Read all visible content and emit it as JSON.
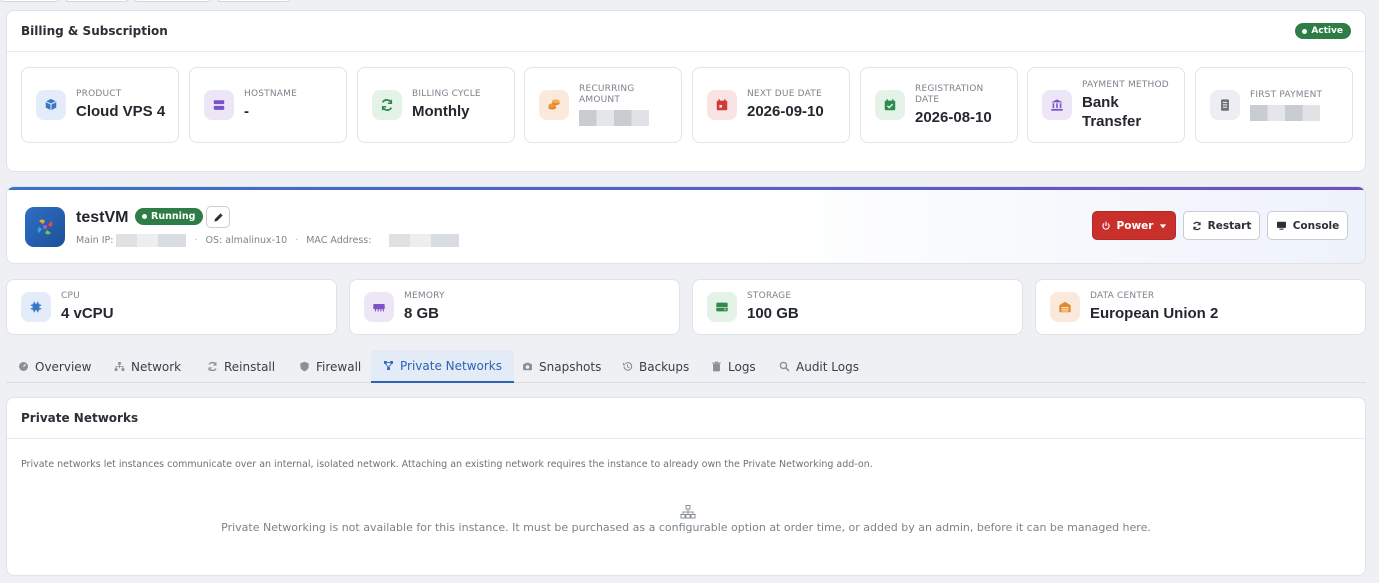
{
  "billing": {
    "title": "Billing & Subscription",
    "status": "Active",
    "items": [
      {
        "label": "PRODUCT",
        "value": "Cloud VPS 4",
        "icon": "cube-icon"
      },
      {
        "label": "HOSTNAME",
        "value": "-",
        "icon": "server-icon"
      },
      {
        "label": "BILLING CYCLE",
        "value": "Monthly",
        "icon": "refresh-icon"
      },
      {
        "label": "RECURRING AMOUNT",
        "value": "",
        "icon": "coins-icon"
      },
      {
        "label": "NEXT DUE DATE",
        "value": "2026-09-10",
        "icon": "calendar-icon"
      },
      {
        "label": "REGISTRATION DATE",
        "value": "2026-08-10",
        "icon": "calendar-check-icon"
      },
      {
        "label": "PAYMENT METHOD",
        "value": "Bank Transfer",
        "icon": "bank-icon"
      },
      {
        "label": "FIRST PAYMENT",
        "value": "",
        "icon": "receipt-icon"
      }
    ]
  },
  "vm": {
    "name": "testVM",
    "status": "Running",
    "main_ip_label": "Main IP:",
    "os_label": "OS: almalinux-10",
    "mac_label": "MAC Address:",
    "power_label": "Power",
    "restart_label": "Restart",
    "console_label": "Console"
  },
  "stats": [
    {
      "label": "CPU",
      "value": "4 vCPU",
      "icon": "cpu-icon"
    },
    {
      "label": "MEMORY",
      "value": "8 GB",
      "icon": "memory-icon"
    },
    {
      "label": "STORAGE",
      "value": "100 GB",
      "icon": "storage-icon"
    },
    {
      "label": "DATA CENTER",
      "value": "European Union 2",
      "icon": "warehouse-icon"
    }
  ],
  "tabs": [
    {
      "label": "Overview",
      "icon": "gauge-icon"
    },
    {
      "label": "Network",
      "icon": "network-icon"
    },
    {
      "label": "Reinstall",
      "icon": "refresh-icon"
    },
    {
      "label": "Firewall",
      "icon": "shield-icon"
    },
    {
      "label": "Private Networks",
      "icon": "nodes-icon",
      "active": true
    },
    {
      "label": "Snapshots",
      "icon": "camera-icon"
    },
    {
      "label": "Backups",
      "icon": "history-icon"
    },
    {
      "label": "Logs",
      "icon": "trash-icon"
    },
    {
      "label": "Audit Logs",
      "icon": "search-icon"
    }
  ],
  "private_networks": {
    "title": "Private Networks",
    "description": "Private networks let instances communicate over an internal, isolated network. Attaching an existing network requires the instance to already own the Private Networking add-on.",
    "empty_message": "Private Networking is not available for this instance. It must be purchased as a configurable option at order time, or added by an admin, before it can be managed here."
  },
  "colors": {
    "accent": "#2d62b4",
    "success": "#2e7d46",
    "danger": "#c9302c"
  }
}
